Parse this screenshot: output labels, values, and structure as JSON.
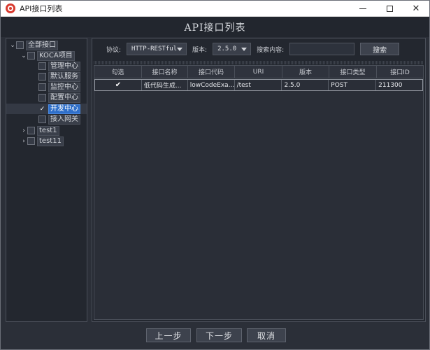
{
  "window": {
    "title": "API接口列表"
  },
  "header": {
    "title": "API接口列表"
  },
  "tree": {
    "nodes": [
      {
        "label": "全部接口",
        "checked": false
      },
      {
        "label": "KOCA项目",
        "checked": false
      },
      {
        "label": "管理中心",
        "checked": false
      },
      {
        "label": "默认服务",
        "checked": false
      },
      {
        "label": "监控中心",
        "checked": false
      },
      {
        "label": "配置中心",
        "checked": false
      },
      {
        "label": "开发中心",
        "checked": true
      },
      {
        "label": "接入网关",
        "checked": false
      },
      {
        "label": "test1",
        "checked": false
      },
      {
        "label": "test11",
        "checked": false
      }
    ]
  },
  "toolbar": {
    "protocol_label": "协议:",
    "protocol_value": "HTTP-RESTful",
    "version_label": "版本:",
    "version_value": "2.5.0",
    "search_label": "搜索内容:",
    "search_value": "",
    "search_button": "搜索"
  },
  "table": {
    "columns": [
      "勾选",
      "接口名称",
      "接口代码",
      "URI",
      "版本",
      "接口类型",
      "接口ID"
    ],
    "rows": [
      {
        "checked": true,
        "name": "低代码生成...",
        "code": "lowCodeExa...",
        "uri": "/test",
        "version": "2.5.0",
        "type": "POST",
        "id": "211300"
      }
    ]
  },
  "footer": {
    "prev": "上一步",
    "next": "下一步",
    "cancel": "取消"
  },
  "colors": {
    "background": "#2b2f38",
    "panel": "#23272f",
    "selection": "#2f6fc9"
  }
}
